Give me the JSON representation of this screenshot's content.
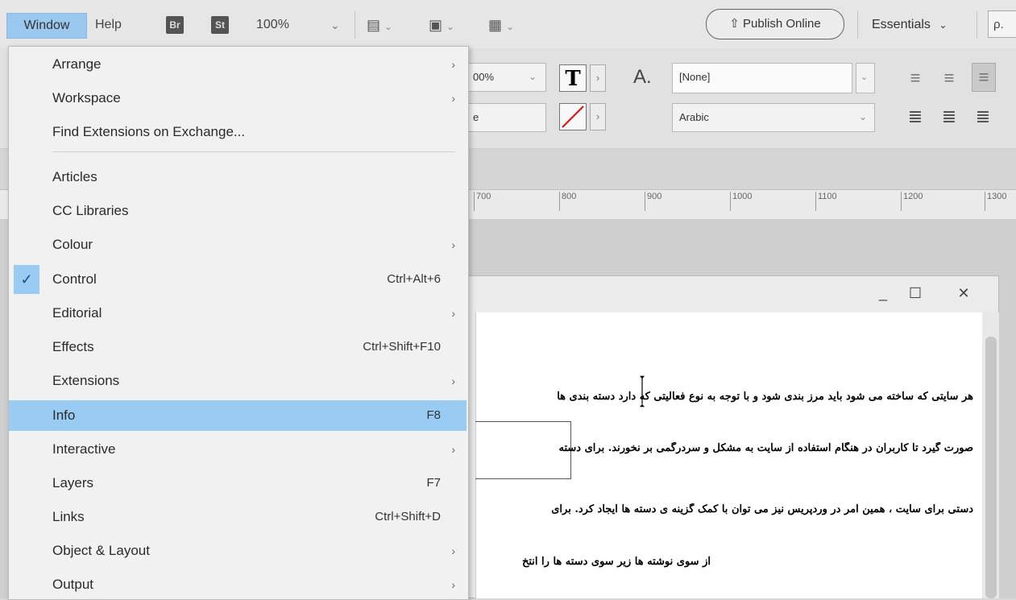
{
  "menubar": {
    "window": "Window",
    "help": "Help",
    "badge_br": "Br",
    "badge_st": "St",
    "zoom": "100%",
    "zoom_arrow": "⌄",
    "publish": "Publish Online",
    "workspace": "Essentials",
    "search": "ρ."
  },
  "control": {
    "field1": "00%",
    "field2": "e",
    "para_style": "[None]",
    "language": "Arabic",
    "char_label": "A."
  },
  "ruler": {
    "ticks": [
      "700",
      "800",
      "900",
      "1000",
      "1100",
      "1200",
      "1300"
    ]
  },
  "doc": {
    "line1": "هر سایتی که ساخته می شود باید مرز بندی شود و با توجه به نوع فعالیتی که دارد دسته بندی ها",
    "line2": "صورت گیرد تا کاربران در هنگام استفاده از سایت به مشکل و سردرگمی بر نخورند. برای  دسته",
    "line3": "دستی برای سایت ، همین امر در وردپریس نیز می توان با کمک گزینه ی دسته ها ایجاد کرد. برای",
    "line4": "از سوی نوشته ها زیر سوی دسته ها را انتخ"
  },
  "menu": {
    "items": [
      {
        "label": "Arrange",
        "shortcut": "",
        "submenu": true
      },
      {
        "label": "Workspace",
        "shortcut": "",
        "submenu": true
      },
      {
        "label": "Find Extensions on Exchange...",
        "shortcut": "",
        "submenu": false
      },
      {
        "label": "Articles",
        "shortcut": "",
        "submenu": false
      },
      {
        "label": "CC Libraries",
        "shortcut": "",
        "submenu": false
      },
      {
        "label": "Colour",
        "shortcut": "",
        "submenu": true
      },
      {
        "label": "Control",
        "shortcut": "Ctrl+Alt+6",
        "submenu": false,
        "checked": true
      },
      {
        "label": "Editorial",
        "shortcut": "",
        "submenu": true
      },
      {
        "label": "Effects",
        "shortcut": "Ctrl+Shift+F10",
        "submenu": false
      },
      {
        "label": "Extensions",
        "shortcut": "",
        "submenu": true
      },
      {
        "label": "Info",
        "shortcut": "F8",
        "submenu": false,
        "highlighted": true
      },
      {
        "label": "Interactive",
        "shortcut": "",
        "submenu": true
      },
      {
        "label": "Layers",
        "shortcut": "F7",
        "submenu": false
      },
      {
        "label": "Links",
        "shortcut": "Ctrl+Shift+D",
        "submenu": false
      },
      {
        "label": "Object & Layout",
        "shortcut": "",
        "submenu": true
      },
      {
        "label": "Output",
        "shortcut": "",
        "submenu": true
      }
    ]
  },
  "colors": {
    "highlight": "#9acbf2",
    "menu_bg": "#f1f1f1"
  }
}
